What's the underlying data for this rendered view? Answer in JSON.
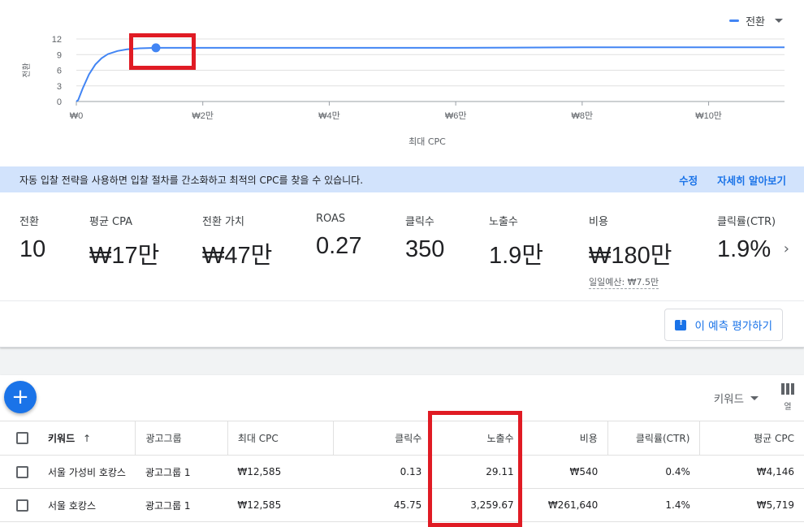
{
  "chart": {
    "legend_label": "전환",
    "legend_color": "#4285f4",
    "ylabel": "전환",
    "xlabel": "최대 CPC"
  },
  "chart_data": {
    "type": "line",
    "title": "",
    "xlabel": "최대 CPC",
    "ylabel": "전환",
    "x_tick_labels": [
      "₩0",
      "₩2만",
      "₩4만",
      "₩6만",
      "₩8만",
      "₩10만"
    ],
    "x_ticks": [
      0,
      20000,
      40000,
      60000,
      80000,
      100000
    ],
    "y_ticks": [
      0,
      3,
      6,
      9,
      12
    ],
    "xlim": [
      0,
      112000
    ],
    "ylim": [
      0,
      12
    ],
    "series": [
      {
        "name": "전환",
        "x": [
          0,
          300,
          1000,
          2000,
          3000,
          4000,
          5000,
          6500,
          8000,
          10000,
          12585,
          15000,
          20000,
          40000,
          60000,
          80000,
          100000,
          112000
        ],
        "y": [
          0,
          0.3,
          2.5,
          5.2,
          7.1,
          8.3,
          9.1,
          9.7,
          10.0,
          10.2,
          10.3,
          10.3,
          10.3,
          10.3,
          10.3,
          10.4,
          10.4,
          10.4
        ]
      }
    ],
    "highlight_point": {
      "x": 12585,
      "y": 10.3
    },
    "grid": true
  },
  "banner": {
    "text": "자동 입찰 전략을 사용하면 입찰 절차를 간소화하고 최적의 CPC를 찾을 수 있습니다.",
    "edit_label": "수정",
    "learn_more_label": "자세히 알아보기"
  },
  "metrics": [
    {
      "label": "전환",
      "value": "10"
    },
    {
      "label": "평균 CPA",
      "value": "₩17만"
    },
    {
      "label": "전환 가치",
      "value": "₩47만"
    },
    {
      "label": "ROAS",
      "value": "0.27"
    },
    {
      "label": "클릭수",
      "value": "350"
    },
    {
      "label": "노출수",
      "value": "1.9만"
    },
    {
      "label": "비용",
      "value": "₩180만",
      "sub": "일일예산: ₩7.5만"
    },
    {
      "label": "클릭률(CTR)",
      "value": "1.9%"
    }
  ],
  "rate_button_label": "이 예측 평가하기",
  "segment_label": "키워드",
  "columns_label": "열",
  "table": {
    "headers": {
      "keyword": "키워드",
      "adgroup": "광고그룹",
      "maxcpc": "최대 CPC",
      "clicks": "클릭수",
      "impressions": "노출수",
      "cost": "비용",
      "ctr": "클릭률(CTR)",
      "avgcpc": "평균 CPC"
    },
    "rows": [
      {
        "keyword": "서울 가성비 호캉스",
        "adgroup": "광고그룹 1",
        "maxcpc": "₩12,585",
        "clicks": "0.13",
        "impressions": "29.11",
        "cost": "₩540",
        "ctr": "0.4%",
        "avgcpc": "₩4,146"
      },
      {
        "keyword": "서울 호캉스",
        "adgroup": "광고그룹 1",
        "maxcpc": "₩12,585",
        "clicks": "45.75",
        "impressions": "3,259.67",
        "cost": "₩261,640",
        "ctr": "1.4%",
        "avgcpc": "₩5,719"
      }
    ]
  },
  "colors": {
    "accent": "#1a73e8",
    "highlight_box": "#e01b24",
    "banner_bg": "#d2e3fc"
  }
}
